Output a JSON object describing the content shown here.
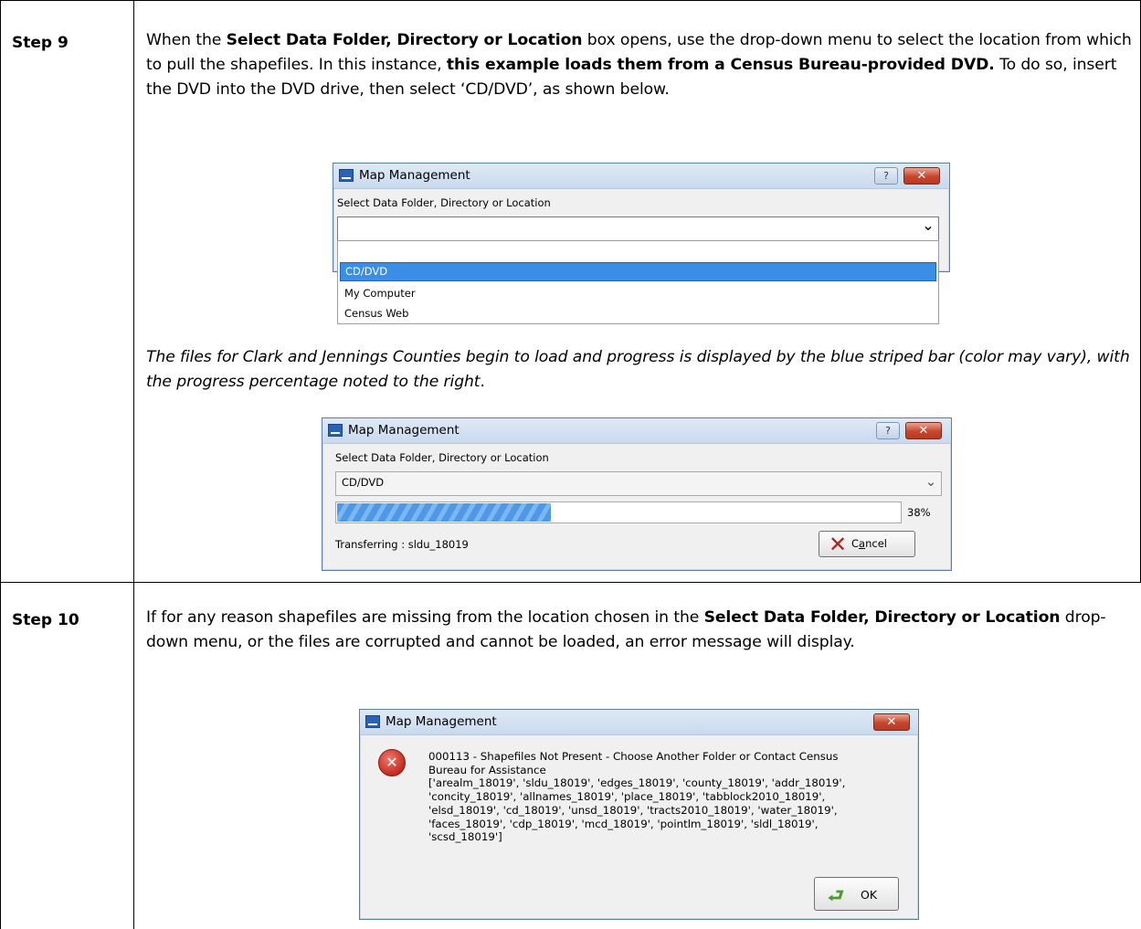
{
  "step9": {
    "label": "Step 9",
    "para1": {
      "t1": "When the ",
      "b1": "Select Data Folder, Directory or Location",
      "t2": " box opens, use the drop-down menu to select the location from which to pull the shapefiles. In this instance, ",
      "b2": "this example loads them from a Census Bureau-provided DVD.",
      "t3": " To do so, insert the DVD into the DVD drive, then select ‘CD/DVD’, as shown below."
    },
    "dialog1": {
      "title": "Map Management",
      "help_label": "?",
      "close_label": "✕",
      "field_label": "Select Data Folder, Directory or Location",
      "combo_value": "",
      "arrow": "⌄",
      "options": [
        "CD/DVD",
        "My Computer",
        "Census Web"
      ],
      "selected_index": 0
    },
    "para2": "The files for Clark and Jennings Counties begin to load and progress is displayed by the blue striped bar (color may vary), with the progress percentage noted to the right",
    "para2_end": ".",
    "dialog2": {
      "title": "Map Management",
      "help_label": "?",
      "close_label": "✕",
      "field_label": "Select Data Folder, Directory or Location",
      "combo_value": "CD/DVD",
      "arrow": "⌄",
      "progress": 0.38,
      "progress_label": "38%",
      "status": "Transferring : sldu_18019",
      "cancel_label_pre": "C",
      "cancel_label_u": "a",
      "cancel_label_post": "ncel"
    }
  },
  "step10": {
    "label": "Step 10",
    "para": {
      "t1": "If for any reason shapefiles are missing from the location chosen in the ",
      "b1": "Select Data Folder, Directory or Location",
      "t2": " drop-down menu, or the files are corrupted and cannot be loaded, an error message will display."
    },
    "dialog3": {
      "title": "Map Management",
      "close_label": "✕",
      "error_lines": [
        "000113 - Shapefiles Not Present - Choose Another Folder or Contact Census",
        "Bureau for Assistance",
        "['arealm_18019', 'sldu_18019', 'edges_18019', 'county_18019', 'addr_18019',",
        "'concity_18019', 'allnames_18019', 'place_18019', 'tabblock2010_18019',",
        "'elsd_18019', 'cd_18019', 'unsd_18019', 'tracts2010_18019', 'water_18019',",
        "'faces_18019', 'cdp_18019', 'mcd_18019', 'pointlm_18019', 'sldl_18019',",
        "'scsd_18019']"
      ],
      "ok_label": "OK"
    }
  },
  "colors": {
    "selection": "#3a8ee6",
    "progress": "#4f98e6",
    "close_button": "#c6452d"
  }
}
